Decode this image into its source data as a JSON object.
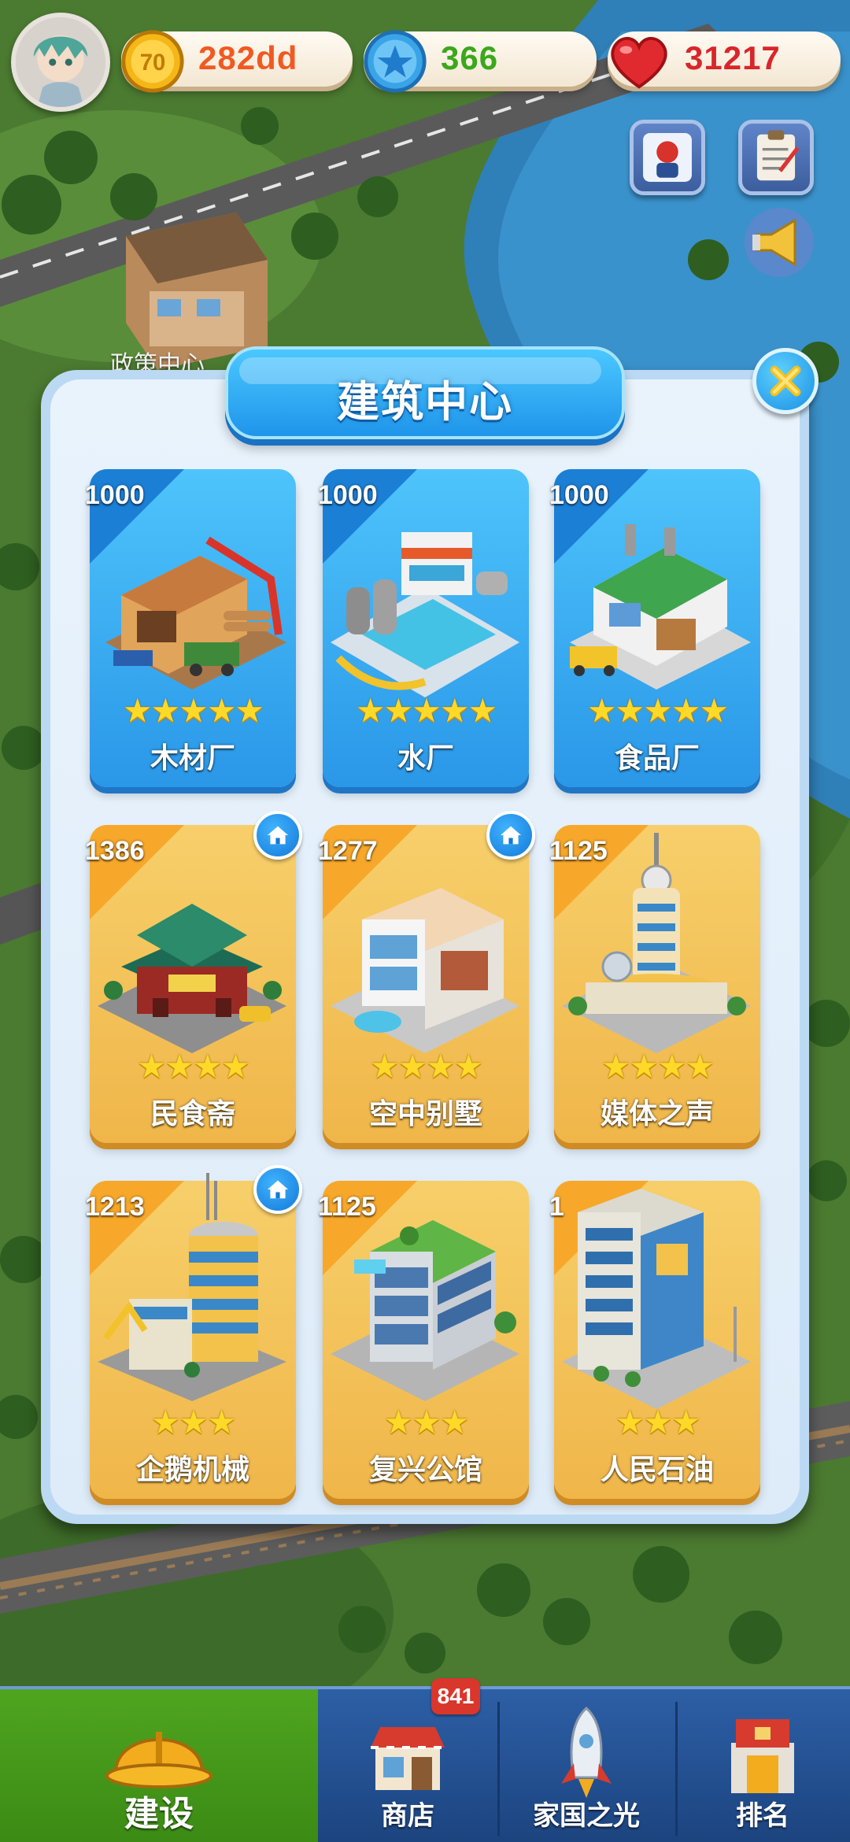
{
  "resources": [
    {
      "icon": "gold-coin-icon",
      "value": "282dd",
      "color": "#f05a22"
    },
    {
      "icon": "blue-star-icon",
      "value": "366",
      "color": "#3aa81c"
    },
    {
      "icon": "heart-icon",
      "value": "31217",
      "color": "#d8262a"
    }
  ],
  "coin_icon_text": "70",
  "map_label": "政策中心",
  "dialog": {
    "title": "建筑中心"
  },
  "buildings": [
    {
      "price": "1000",
      "name": "木材厂",
      "stars": "★★★★★",
      "stars_count": 5,
      "theme": "blue"
    },
    {
      "price": "1000",
      "name": "水厂",
      "stars": "★★★★★",
      "stars_count": 5,
      "theme": "blue"
    },
    {
      "price": "1000",
      "name": "食品厂",
      "stars": "★★★★★",
      "stars_count": 5,
      "theme": "blue"
    },
    {
      "price": "1386",
      "name": "民食斋",
      "stars": "★★★★",
      "stars_count": 4,
      "theme": "gold",
      "home_badge": true
    },
    {
      "price": "1277",
      "name": "空中别墅",
      "stars": "★★★★",
      "stars_count": 4,
      "theme": "gold",
      "home_badge": true
    },
    {
      "price": "1125",
      "name": "媒体之声",
      "stars": "★★★★",
      "stars_count": 4,
      "theme": "gold"
    },
    {
      "price": "1213",
      "name": "企鹅机械",
      "stars": "★★★",
      "stars_count": 3,
      "theme": "gold",
      "home_badge": true
    },
    {
      "price": "1125",
      "name": "复兴公馆",
      "stars": "★★★",
      "stars_count": 3,
      "theme": "gold"
    },
    {
      "price": "1",
      "name": "人民石油",
      "stars": "★★★",
      "stars_count": 3,
      "theme": "gold"
    }
  ],
  "nav": {
    "items": [
      {
        "label": "建设",
        "icon": "hard-hat-icon",
        "active": true
      },
      {
        "label": "商店",
        "icon": "shop-icon",
        "badge": "841"
      },
      {
        "label": "家国之光",
        "icon": "rocket-icon"
      },
      {
        "label": "排名",
        "icon": "ranking-icon"
      }
    ]
  },
  "colors": {
    "card_blue": "#2a97e8",
    "card_gold": "#f0b64a",
    "nav_bg": "#1c447f",
    "nav_active": "#3b8a15"
  }
}
